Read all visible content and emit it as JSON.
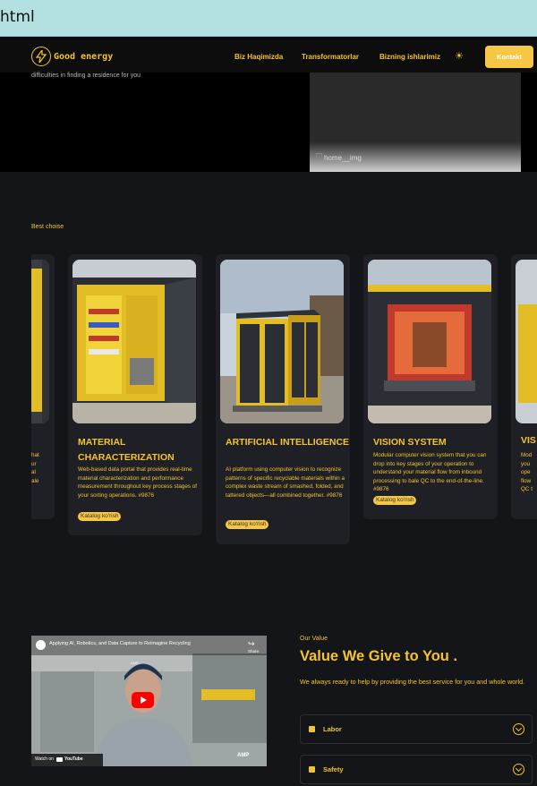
{
  "browser": {
    "url_fragment": "html"
  },
  "nav": {
    "brand": "Good energy",
    "links": [
      "Biz Haqimizda",
      "Transformatorlar",
      "Bizning ishlarimiz"
    ],
    "contact_label": "Kontakt"
  },
  "hero": {
    "text": "difficulties in finding a residence for you",
    "image_alt": "home__img"
  },
  "section": {
    "label": "Best choise"
  },
  "cards": [
    {
      "title": "MATERIAL CHARACTERIZATION",
      "description": "Web-based data portal that provides real-time material characterization and performance measurement throughout key process stages of your sorting operations. #9876",
      "button": "Katalog ko'rish"
    },
    {
      "title": "ARTIFICIAL INTELLIGENCE",
      "description": "AI platform using computer vision to recognize patterns of specific recyclable materials within a complex waste stream of smashed, folded, and tattered objects—all combined together. #9876",
      "button": "Katalog ko'rish"
    },
    {
      "title": "VISION SYSTEM",
      "description": "Modular computer vision system that you can drop into key stages of your operation to understand your material flow from inbound processing to bale QC to the end-of-the-line. #9876",
      "button": "Katalog ko'rish"
    }
  ],
  "partial_cards": {
    "left_lines": [
      "hat",
      "ur",
      "al",
      "ale"
    ],
    "right_title": "VIS",
    "right_lines": [
      "Mod",
      "you",
      "ope",
      "flow",
      "QC t"
    ]
  },
  "video": {
    "title": "Applying AI, Robotics, and Data Capture to Reimagine Recycling",
    "share": "Share",
    "watch_on": "Watch on",
    "youtube": "YouTube",
    "cap_text": "AMP",
    "watermark": "AMP"
  },
  "value": {
    "label": "Our Value",
    "title": "Value We Give to You .",
    "subtitle": "We always ready to help by providing the best service for you and whole world.",
    "items": [
      "Labor",
      "Safety"
    ]
  }
}
